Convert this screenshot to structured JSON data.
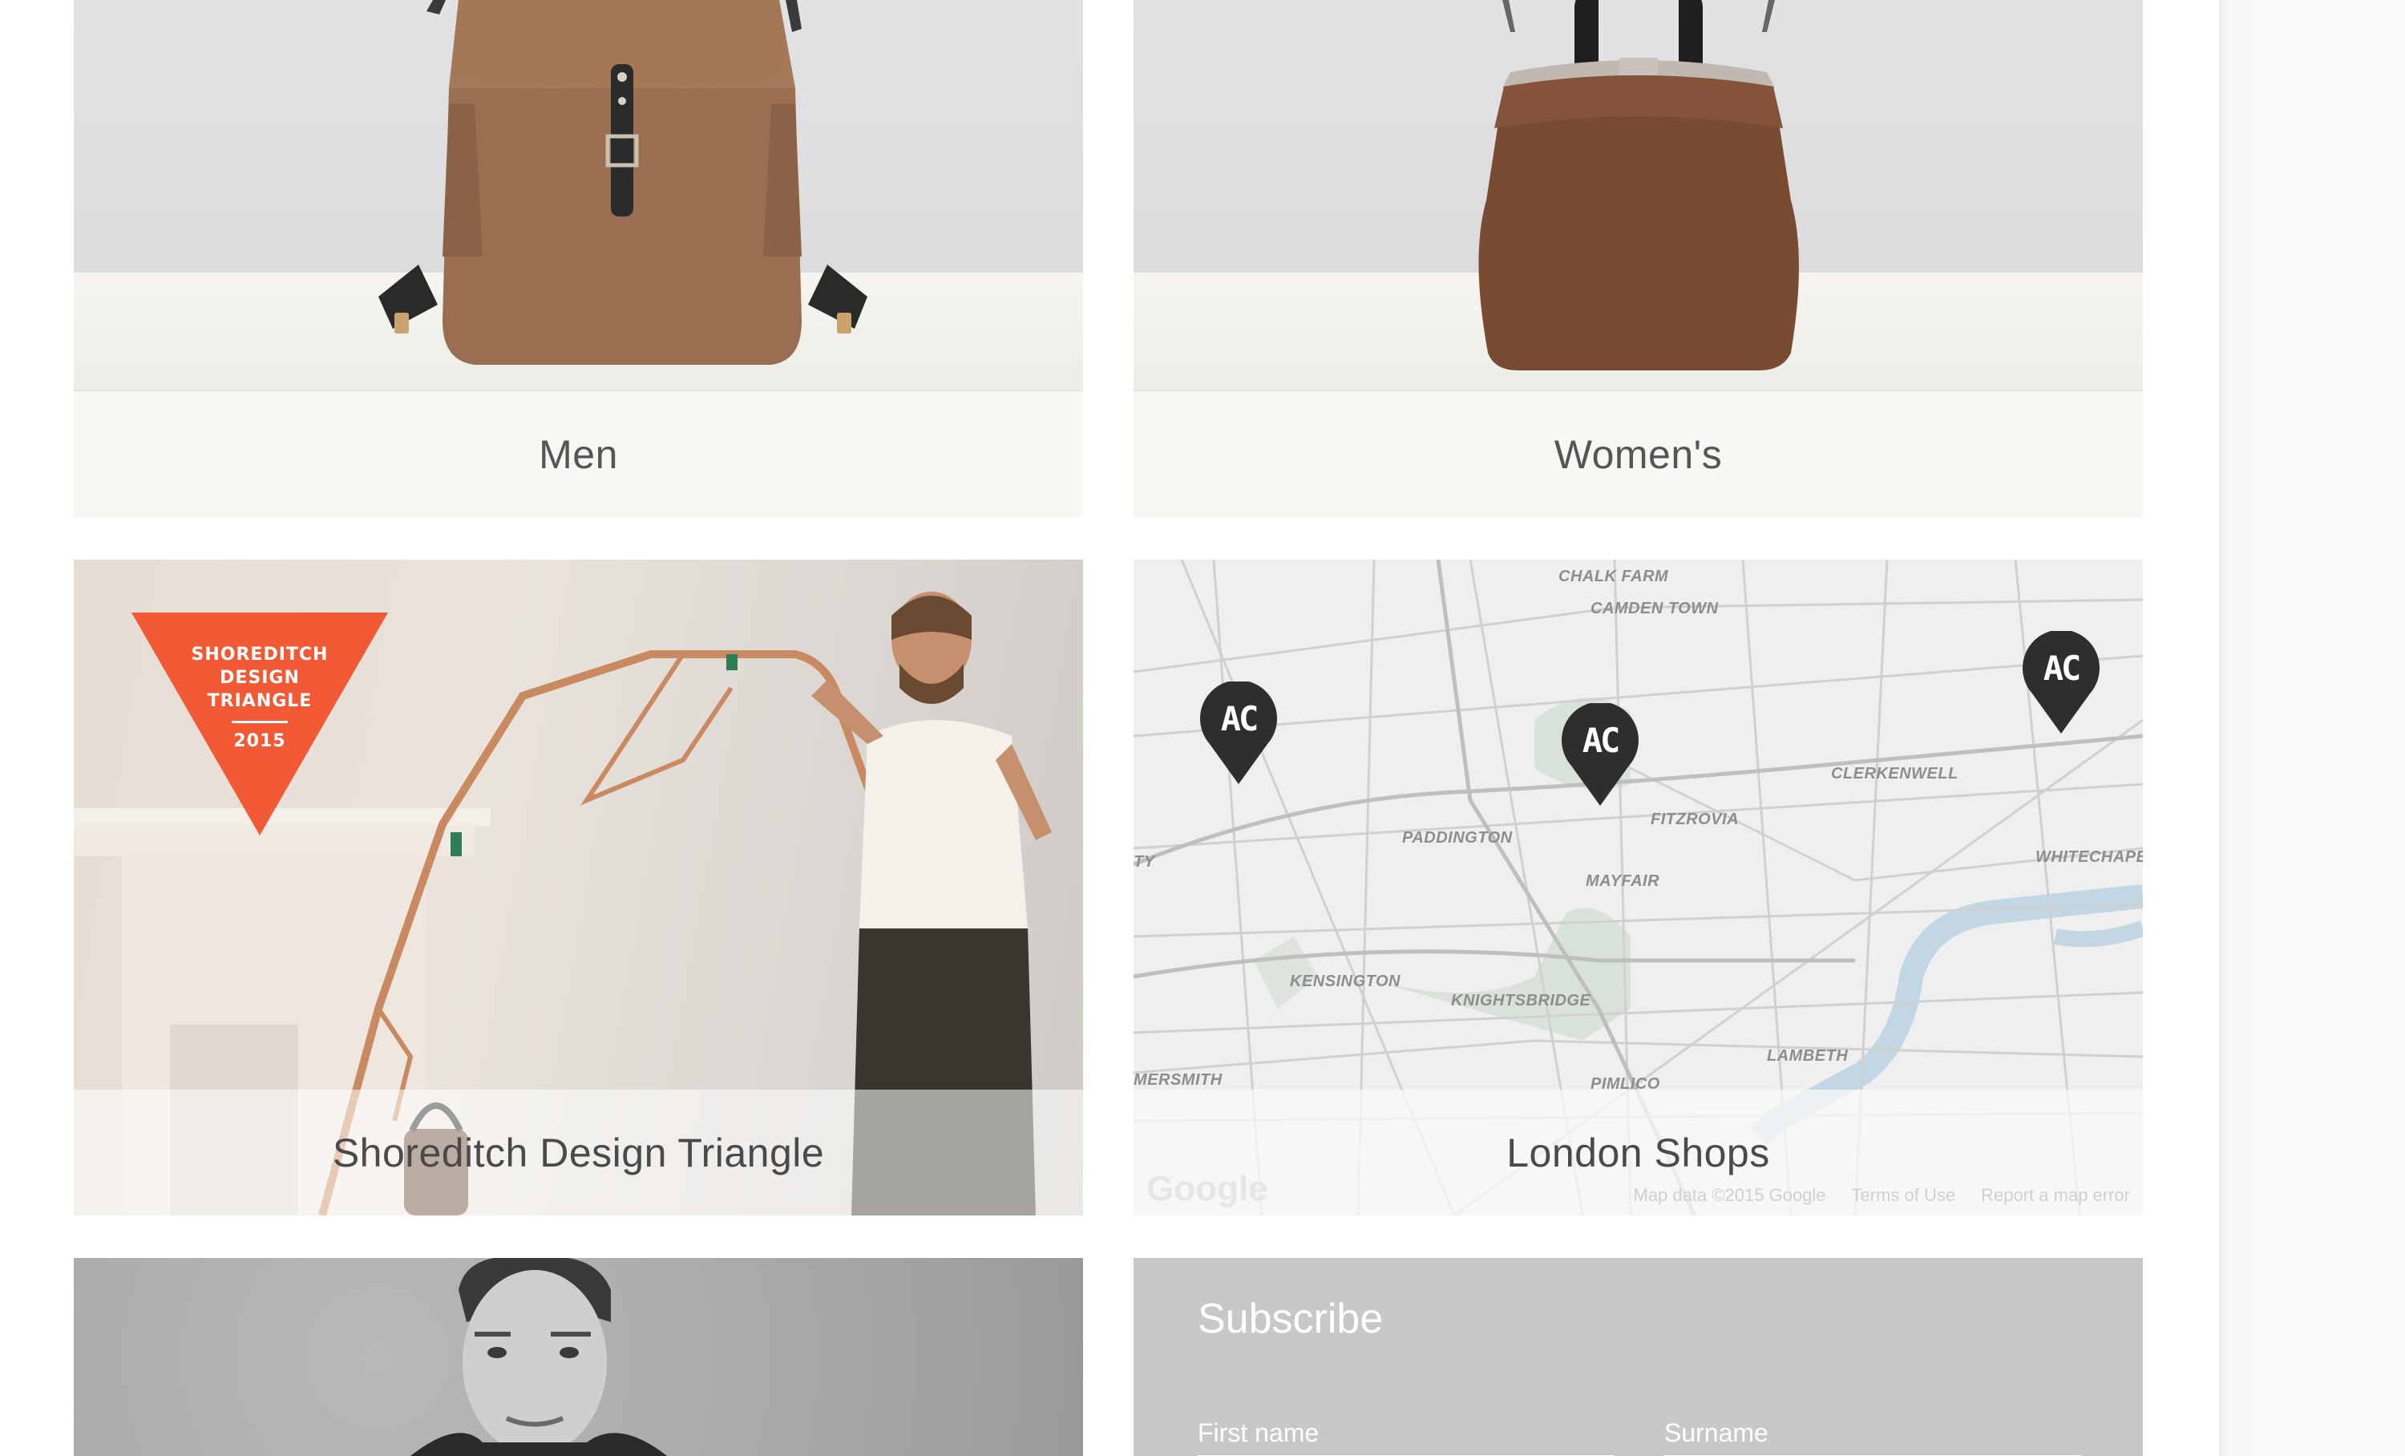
{
  "tiles": {
    "men": {
      "label": "Men"
    },
    "womens": {
      "label": "Women's"
    },
    "shoreditch": {
      "label": "Shoreditch Design Triangle",
      "badge_line1": "SHOREDITCH",
      "badge_line2": "DESIGN",
      "badge_line3": "TRIANGLE",
      "badge_year": "2015"
    },
    "london_shops": {
      "label": "London Shops",
      "map_labels": {
        "chalk_farm": "CHALK FARM",
        "camden_town": "CAMDEN TOWN",
        "clerkenwell": "CLERKENWELL",
        "whitechapel": "WHITECHAPE",
        "fitzrovia": "FITZROVIA",
        "paddington": "PADDINGTON",
        "mayfair": "MAYFAIR",
        "kensington": "KENSINGTON",
        "knightsbridge": "KNIGHTSBRIDGE",
        "lambeth": "LAMBETH",
        "hammersmith": "MERSMITH",
        "pimlico": "PIMLICO",
        "city": "TY"
      },
      "pin_text": "AC",
      "google_logo": "Google",
      "map_data": "Map data ©2015 Google",
      "terms": "Terms of Use",
      "report": "Report a map error"
    }
  },
  "subscribe": {
    "title": "Subscribe",
    "first_name_label": "First name",
    "surname_label": "Surname"
  },
  "colors": {
    "badge": "#f15a35",
    "backpack": "#9a6e50",
    "handbag": "#7a4b33",
    "pin": "#2e2e2e"
  }
}
